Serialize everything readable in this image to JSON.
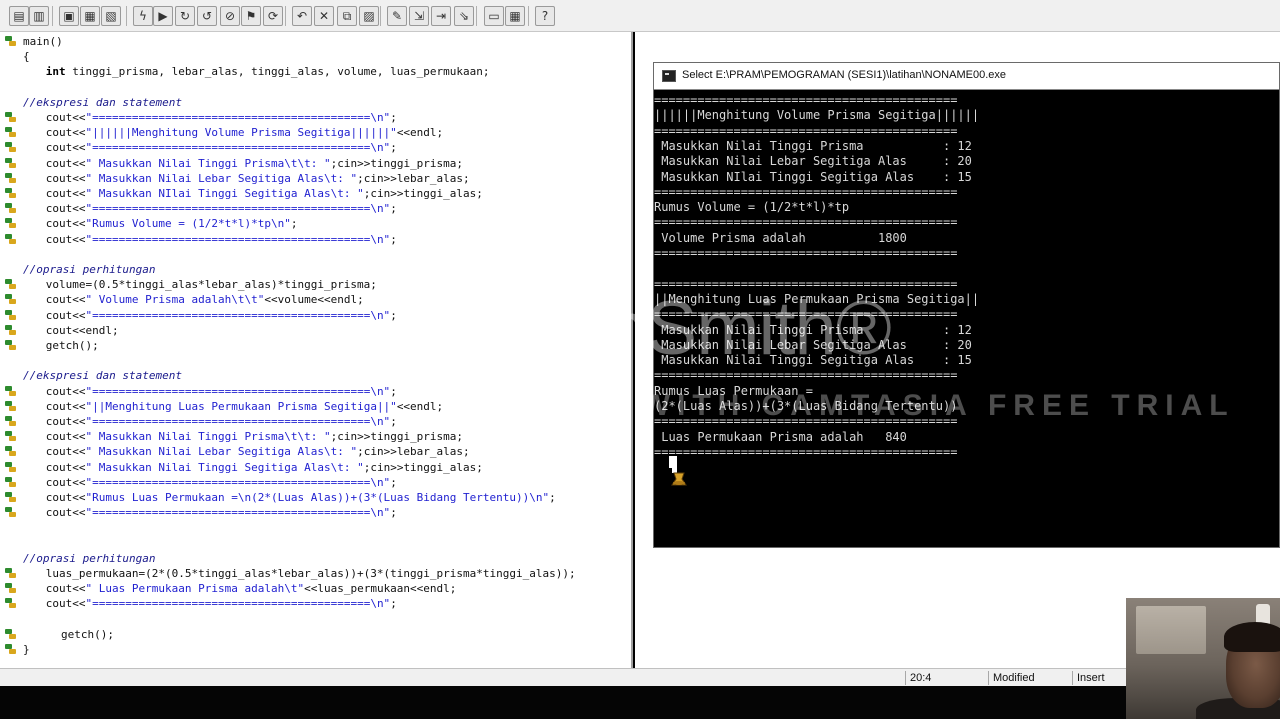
{
  "toolbar": {
    "buttons": [
      {
        "name": "new-source-icon",
        "glyph": "▤"
      },
      {
        "name": "new-project-icon",
        "glyph": "▥"
      },
      {
        "name": "open-project-icon",
        "glyph": "▣"
      },
      {
        "name": "save-icon",
        "glyph": "▦"
      },
      {
        "name": "save-all-icon",
        "glyph": "▧"
      },
      {
        "name": "compile-icon",
        "glyph": "ϟ"
      },
      {
        "name": "run-icon",
        "glyph": "▶"
      },
      {
        "name": "compile-run-icon",
        "glyph": "↻"
      },
      {
        "name": "rebuild-icon",
        "glyph": "↺"
      },
      {
        "name": "stop-icon",
        "glyph": "⊘"
      },
      {
        "name": "debug-icon",
        "glyph": "⚑"
      },
      {
        "name": "check-syntax-icon",
        "glyph": "⟳"
      },
      {
        "name": "undo-icon",
        "glyph": "↶"
      },
      {
        "name": "cut-icon",
        "glyph": "✕"
      },
      {
        "name": "copy-icon",
        "glyph": "⧉"
      },
      {
        "name": "paste-icon",
        "glyph": "▨"
      },
      {
        "name": "add-watch-icon",
        "glyph": "✎"
      },
      {
        "name": "step-into-icon",
        "glyph": "⇲"
      },
      {
        "name": "step-over-icon",
        "glyph": "⇥"
      },
      {
        "name": "run-to-cursor-icon",
        "glyph": "⇘"
      },
      {
        "name": "class-browser-icon",
        "glyph": "▭"
      },
      {
        "name": "project-manager-icon",
        "glyph": "▦"
      },
      {
        "name": "help-icon",
        "glyph": "?"
      }
    ]
  },
  "editor": {
    "lines": [
      {
        "bm": true,
        "indent": 0,
        "kind": "code",
        "text": "main()"
      },
      {
        "bm": false,
        "indent": 0,
        "kind": "code",
        "text": "{"
      },
      {
        "bm": false,
        "indent": 3,
        "kind": "decl",
        "kw": "int",
        "text": " tinggi_prisma, lebar_alas, tinggi_alas, volume, luas_permukaan;"
      },
      {
        "bm": false,
        "indent": 0,
        "kind": "blank",
        "text": ""
      },
      {
        "bm": false,
        "indent": 0,
        "kind": "comment",
        "text": "//ekspresi dan statement"
      },
      {
        "bm": true,
        "indent": 3,
        "kind": "str",
        "pre": "cout<<",
        "str": "\"==========================================\\n\"",
        "post": ";"
      },
      {
        "bm": true,
        "indent": 3,
        "kind": "str",
        "pre": "cout<<",
        "str": "\"||||||Menghitung Volume Prisma Segitiga||||||\"",
        "post": "<<endl;"
      },
      {
        "bm": true,
        "indent": 3,
        "kind": "str",
        "pre": "cout<<",
        "str": "\"==========================================\\n\"",
        "post": ";"
      },
      {
        "bm": true,
        "indent": 3,
        "kind": "str",
        "pre": "cout<<",
        "str": "\" Masukkan Nilai Tinggi Prisma\\t\\t: \"",
        "post": ";cin>>tinggi_prisma;"
      },
      {
        "bm": true,
        "indent": 3,
        "kind": "str",
        "pre": "cout<<",
        "str": "\" Masukkan Nilai Lebar Segitiga Alas\\t: \"",
        "post": ";cin>>lebar_alas;"
      },
      {
        "bm": true,
        "indent": 3,
        "kind": "str",
        "pre": "cout<<",
        "str": "\" Masukkan NIlai Tinggi Segitiga Alas\\t: \"",
        "post": ";cin>>tinggi_alas;"
      },
      {
        "bm": true,
        "indent": 3,
        "kind": "str",
        "pre": "cout<<",
        "str": "\"==========================================\\n\"",
        "post": ";"
      },
      {
        "bm": true,
        "indent": 3,
        "kind": "str",
        "pre": "cout<<",
        "str": "\"Rumus Volume = (1/2*t*l)*tp\\n\"",
        "post": ";"
      },
      {
        "bm": true,
        "indent": 3,
        "kind": "str",
        "pre": "cout<<",
        "str": "\"==========================================\\n\"",
        "post": ";"
      },
      {
        "bm": false,
        "indent": 0,
        "kind": "blank",
        "text": ""
      },
      {
        "bm": false,
        "indent": 0,
        "kind": "comment",
        "text": "//oprasi perhitungan"
      },
      {
        "bm": true,
        "indent": 3,
        "kind": "code",
        "text": "volume=(0.5*tinggi_alas*lebar_alas)*tinggi_prisma;"
      },
      {
        "bm": true,
        "indent": 3,
        "kind": "str",
        "pre": "cout<<",
        "str": "\" Volume Prisma adalah\\t\\t\"",
        "post": "<<volume<<endl;"
      },
      {
        "bm": true,
        "indent": 3,
        "kind": "str",
        "pre": "cout<<",
        "str": "\"==========================================\\n\"",
        "post": ";"
      },
      {
        "bm": true,
        "indent": 3,
        "kind": "code",
        "text": "cout<<endl;"
      },
      {
        "bm": true,
        "indent": 3,
        "kind": "code",
        "text": "getch();"
      },
      {
        "bm": false,
        "indent": 0,
        "kind": "blank",
        "text": ""
      },
      {
        "bm": false,
        "indent": 0,
        "kind": "comment",
        "text": "//ekspresi dan statement"
      },
      {
        "bm": true,
        "indent": 3,
        "kind": "str",
        "pre": "cout<<",
        "str": "\"==========================================\\n\"",
        "post": ";"
      },
      {
        "bm": true,
        "indent": 3,
        "kind": "str",
        "pre": "cout<<",
        "str": "\"||Menghitung Luas Permukaan Prisma Segitiga||\"",
        "post": "<<endl;"
      },
      {
        "bm": true,
        "indent": 3,
        "kind": "str",
        "pre": "cout<<",
        "str": "\"==========================================\\n\"",
        "post": ";"
      },
      {
        "bm": true,
        "indent": 3,
        "kind": "str",
        "pre": "cout<<",
        "str": "\" Masukkan Nilai Tinggi Prisma\\t\\t: \"",
        "post": ";cin>>tinggi_prisma;"
      },
      {
        "bm": true,
        "indent": 3,
        "kind": "str",
        "pre": "cout<<",
        "str": "\" Masukkan Nilai Lebar Segitiga Alas\\t: \"",
        "post": ";cin>>lebar_alas;"
      },
      {
        "bm": true,
        "indent": 3,
        "kind": "str",
        "pre": "cout<<",
        "str": "\" Masukkan Nilai Tinggi Segitiga Alas\\t: \"",
        "post": ";cin>>tinggi_alas;"
      },
      {
        "bm": true,
        "indent": 3,
        "kind": "str",
        "pre": "cout<<",
        "str": "\"==========================================\\n\"",
        "post": ";"
      },
      {
        "bm": true,
        "indent": 3,
        "kind": "str",
        "pre": "cout<<",
        "str": "\"Rumus Luas Permukaan =\\n(2*(Luas Alas))+(3*(Luas Bidang Tertentu))\\n\"",
        "post": ";"
      },
      {
        "bm": true,
        "indent": 3,
        "kind": "str",
        "pre": "cout<<",
        "str": "\"==========================================\\n\"",
        "post": ";"
      },
      {
        "bm": false,
        "indent": 0,
        "kind": "blank",
        "text": ""
      },
      {
        "bm": false,
        "indent": 0,
        "kind": "blank",
        "text": ""
      },
      {
        "bm": false,
        "indent": 0,
        "kind": "comment",
        "text": "//oprasi perhitungan"
      },
      {
        "bm": true,
        "indent": 3,
        "kind": "code",
        "text": "luas_permukaan=(2*(0.5*tinggi_alas*lebar_alas))+(3*(tinggi_prisma*tinggi_alas));"
      },
      {
        "bm": true,
        "indent": 3,
        "kind": "str",
        "pre": "cout<<",
        "str": "\" Luas Permukaan Prisma adalah\\t\"",
        "post": "<<luas_permukaan<<endl;"
      },
      {
        "bm": true,
        "indent": 3,
        "kind": "str",
        "pre": "cout<<",
        "str": "\"==========================================\\n\"",
        "post": ";"
      },
      {
        "bm": false,
        "indent": 0,
        "kind": "blank",
        "text": ""
      },
      {
        "bm": true,
        "indent": 5,
        "kind": "code",
        "text": "getch();"
      },
      {
        "bm": true,
        "indent": 0,
        "kind": "code",
        "text": "}"
      }
    ]
  },
  "console": {
    "title": "Select E:\\PRAM\\PEMOGRAMAN (SESI1)\\latihan\\NONAME00.exe",
    "lines": [
      "==========================================",
      "||||||Menghitung Volume Prisma Segitiga||||||",
      "==========================================",
      " Masukkan Nilai Tinggi Prisma           : 12",
      " Masukkan Nilai Lebar Segitiga Alas     : 20",
      " Masukkan NIlai Tinggi Segitiga Alas    : 15",
      "==========================================",
      "Rumus Volume = (1/2*t*l)*tp",
      "==========================================",
      " Volume Prisma adalah          1800",
      "==========================================",
      "",
      "==========================================",
      "||Menghitung Luas Permukaan Prisma Segitiga||",
      "==========================================",
      " Masukkan Nilai Tinggi Prisma           : 12",
      " Masukkan Nilai Lebar Segitiga Alas     : 20",
      " Masukkan Nilai Tinggi Segitiga Alas    : 15",
      "==========================================",
      "Rumus Luas Permukaan =",
      "(2*(Luas Alas))+(3*(Luas Bidang Tertentu))",
      "==========================================",
      " Luas Permukaan Prisma adalah   840",
      "=========================================="
    ]
  },
  "watermark": {
    "title": "TechSmith®",
    "subtitle": "MADE WITH CAMTASIA FREE TRIAL"
  },
  "status": {
    "position": "20:4",
    "modified": "Modified",
    "mode": "Insert"
  }
}
